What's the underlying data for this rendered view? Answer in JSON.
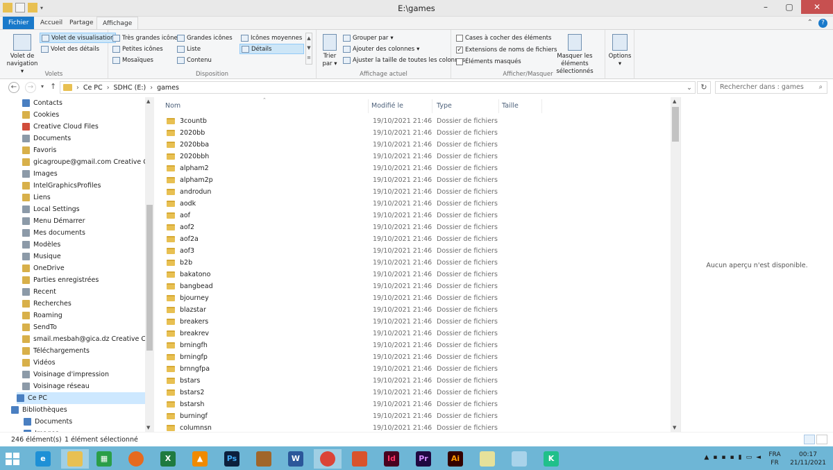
{
  "window": {
    "title": "E:\\games"
  },
  "ribbon_tabs": [
    "Fichier",
    "Accueil",
    "Partage",
    "Affichage"
  ],
  "ribbon": {
    "volets": {
      "label": "Volets",
      "nav_pane": "Volet de navigation",
      "preview_pane": "Volet de visualisation",
      "details_pane": "Volet des détails"
    },
    "disposition": {
      "label": "Disposition",
      "items": [
        "Très grandes icônes",
        "Grandes icônes",
        "Icônes moyennes",
        "Petites icônes",
        "Liste",
        "Détails",
        "Mosaïques",
        "Contenu"
      ]
    },
    "affichage_actuel": {
      "label": "Affichage actuel",
      "sort": "Trier par",
      "group": "Grouper par",
      "add_cols": "Ajouter des colonnes",
      "fit_cols": "Ajuster la taille de toutes les colonnes"
    },
    "afficher_masquer": {
      "label": "Afficher/Masquer",
      "checkboxes": "Cases à cocher des éléments",
      "extensions": "Extensions de noms de fichiers",
      "hidden": "Éléments masqués",
      "hide_selected": "Masquer les éléments sélectionnés"
    },
    "options": "Options"
  },
  "address": {
    "crumbs": [
      "Ce PC",
      "SDHC (E:)",
      "games"
    ],
    "search_placeholder": "Rechercher dans : games"
  },
  "nav_items": [
    "Contacts",
    "Cookies",
    "Creative Cloud Files",
    "Documents",
    "Favoris",
    "gicagroupe@gmail.com Creative Cloud",
    "Images",
    "IntelGraphicsProfiles",
    "Liens",
    "Local Settings",
    "Menu Démarrer",
    "Mes documents",
    "Modèles",
    "Musique",
    "OneDrive",
    "Parties enregistrées",
    "Recent",
    "Recherches",
    "Roaming",
    "SendTo",
    "smail.mesbah@gica.dz Creative Cloud",
    "Téléchargements",
    "Vidéos",
    "Voisinage d'impression",
    "Voisinage réseau"
  ],
  "nav_tree": [
    "Ce PC",
    "Bibliothèques",
    "Documents",
    "Images"
  ],
  "columns": [
    "Nom",
    "Modifié le",
    "Type",
    "Taille"
  ],
  "files": [
    {
      "name": "3countb",
      "date": "19/10/2021 21:46",
      "type": "Dossier de fichiers"
    },
    {
      "name": "2020bb",
      "date": "19/10/2021 21:46",
      "type": "Dossier de fichiers"
    },
    {
      "name": "2020bba",
      "date": "19/10/2021 21:46",
      "type": "Dossier de fichiers"
    },
    {
      "name": "2020bbh",
      "date": "19/10/2021 21:46",
      "type": "Dossier de fichiers"
    },
    {
      "name": "alpham2",
      "date": "19/10/2021 21:46",
      "type": "Dossier de fichiers"
    },
    {
      "name": "alpham2p",
      "date": "19/10/2021 21:46",
      "type": "Dossier de fichiers"
    },
    {
      "name": "androdun",
      "date": "19/10/2021 21:46",
      "type": "Dossier de fichiers"
    },
    {
      "name": "aodk",
      "date": "19/10/2021 21:46",
      "type": "Dossier de fichiers"
    },
    {
      "name": "aof",
      "date": "19/10/2021 21:46",
      "type": "Dossier de fichiers"
    },
    {
      "name": "aof2",
      "date": "19/10/2021 21:46",
      "type": "Dossier de fichiers"
    },
    {
      "name": "aof2a",
      "date": "19/10/2021 21:46",
      "type": "Dossier de fichiers"
    },
    {
      "name": "aof3",
      "date": "19/10/2021 21:46",
      "type": "Dossier de fichiers"
    },
    {
      "name": "b2b",
      "date": "19/10/2021 21:46",
      "type": "Dossier de fichiers"
    },
    {
      "name": "bakatono",
      "date": "19/10/2021 21:46",
      "type": "Dossier de fichiers"
    },
    {
      "name": "bangbead",
      "date": "19/10/2021 21:46",
      "type": "Dossier de fichiers"
    },
    {
      "name": "bjourney",
      "date": "19/10/2021 21:46",
      "type": "Dossier de fichiers"
    },
    {
      "name": "blazstar",
      "date": "19/10/2021 21:46",
      "type": "Dossier de fichiers"
    },
    {
      "name": "breakers",
      "date": "19/10/2021 21:46",
      "type": "Dossier de fichiers"
    },
    {
      "name": "breakrev",
      "date": "19/10/2021 21:46",
      "type": "Dossier de fichiers"
    },
    {
      "name": "brningfh",
      "date": "19/10/2021 21:46",
      "type": "Dossier de fichiers"
    },
    {
      "name": "brningfp",
      "date": "19/10/2021 21:46",
      "type": "Dossier de fichiers"
    },
    {
      "name": "brnngfpa",
      "date": "19/10/2021 21:46",
      "type": "Dossier de fichiers"
    },
    {
      "name": "bstars",
      "date": "19/10/2021 21:46",
      "type": "Dossier de fichiers"
    },
    {
      "name": "bstars2",
      "date": "19/10/2021 21:46",
      "type": "Dossier de fichiers"
    },
    {
      "name": "bstarsh",
      "date": "19/10/2021 21:46",
      "type": "Dossier de fichiers"
    },
    {
      "name": "burningf",
      "date": "19/10/2021 21:46",
      "type": "Dossier de fichiers"
    },
    {
      "name": "columnsn",
      "date": "19/10/2021 21:46",
      "type": "Dossier de fichiers"
    }
  ],
  "preview_text": "Aucun aperçu n'est disponible.",
  "status": {
    "count": "246 élément(s)",
    "selected": "1 élément sélectionné"
  },
  "taskbar": {
    "lang": [
      "FRA",
      "FR"
    ],
    "time": "00:17",
    "date": "21/11/2021"
  }
}
